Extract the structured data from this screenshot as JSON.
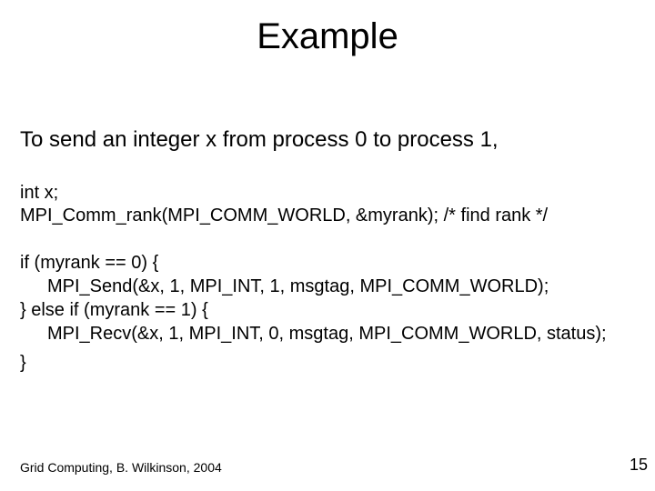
{
  "title": "Example",
  "intro": "To send an integer x from process 0 to process 1,",
  "code1_line1": "int x;",
  "code1_line2": "MPI_Comm_rank(MPI_COMM_WORLD, &myrank); /* find rank */",
  "code2_line1": "if (myrank == 0) {",
  "code2_line2": "MPI_Send(&x, 1, MPI_INT, 1, msgtag, MPI_COMM_WORLD);",
  "code2_line3": "} else if (myrank == 1) {",
  "code2_line4": "MPI_Recv(&x, 1, MPI_INT, 0, msgtag, MPI_COMM_WORLD, status);",
  "code2_line5": "}",
  "footer_left": "Grid Computing, B. Wilkinson, 2004",
  "footer_right": "15"
}
